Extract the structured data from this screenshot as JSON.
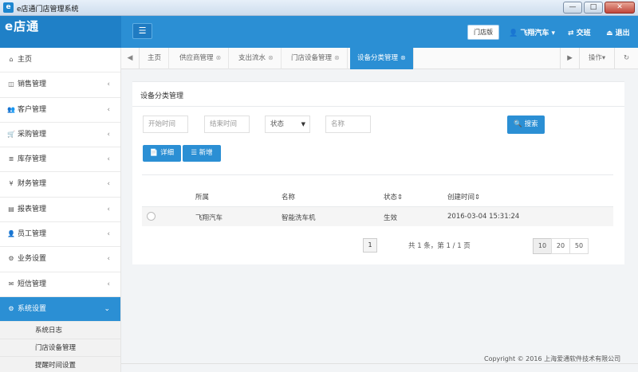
{
  "window": {
    "title": "e店通门店管理系统",
    "minimize": "—",
    "maximize": "□",
    "close": "✕"
  },
  "header": {
    "logo": "e店通",
    "menu_toggle": "☰",
    "store_button": "门店版",
    "user": "👤 飞翔汽车 ▾",
    "switch": "⇄ 交班",
    "logout": "⏏ 退出"
  },
  "sidebar": {
    "items": [
      {
        "label": "主页",
        "icon": "⌂"
      },
      {
        "label": "销售管理",
        "icon": "◫",
        "chev": "‹"
      },
      {
        "label": "客户管理",
        "icon": "👥",
        "chev": "‹"
      },
      {
        "label": "采购管理",
        "icon": "🛒",
        "chev": "‹"
      },
      {
        "label": "库存管理",
        "icon": "≣",
        "chev": "‹"
      },
      {
        "label": "财务管理",
        "icon": "¥",
        "chev": "‹"
      },
      {
        "label": "报表管理",
        "icon": "▤",
        "chev": "‹"
      },
      {
        "label": "员工管理",
        "icon": "👤",
        "chev": "‹"
      },
      {
        "label": "业务设置",
        "icon": "⚙",
        "chev": "‹"
      },
      {
        "label": "短信管理",
        "icon": "✉",
        "chev": "‹"
      },
      {
        "label": "系统设置",
        "icon": "⚙",
        "chev": "⌄"
      }
    ],
    "sub_items": [
      "系统日志",
      "门店设备管理",
      "提醒时间设置"
    ]
  },
  "tabs": {
    "prev": "◀",
    "items": [
      {
        "label": "主页",
        "close": ""
      },
      {
        "label": "供应商管理",
        "close": "⊗"
      },
      {
        "label": "支出流水",
        "close": "⊗"
      },
      {
        "label": "门店设备管理",
        "close": "⊗"
      },
      {
        "label": "设备分类管理",
        "close": "⊗"
      }
    ],
    "next": "▶",
    "actions": "操作▾",
    "refresh": "↻"
  },
  "panel": {
    "title": "设备分类管理",
    "start_time": "开始时间",
    "end_time": "结束时间",
    "status_select": "状态",
    "status_caret": "▼",
    "name_placeholder": "名称",
    "search": "🔍 搜索",
    "detail": "📄 详细",
    "add": "☰ 新增"
  },
  "table": {
    "headers": [
      "所属",
      "名称",
      "状态⇕",
      "创建时间⇕"
    ],
    "rows": [
      {
        "owner": "飞翔汽车",
        "name": "智能洗车机",
        "status": "生效",
        "created": "2016-03-04 15:31:24"
      }
    ]
  },
  "pagination": {
    "current": "1",
    "info": "共 1 条，第 1 / 1 页",
    "sizes": [
      "10",
      "20",
      "50"
    ]
  },
  "footer": "Copyright © 2016 上海爱通软件技术有限公司",
  "colors": {
    "primary": "#2b8fd4",
    "sidebar_active": "#2b8fd4"
  }
}
